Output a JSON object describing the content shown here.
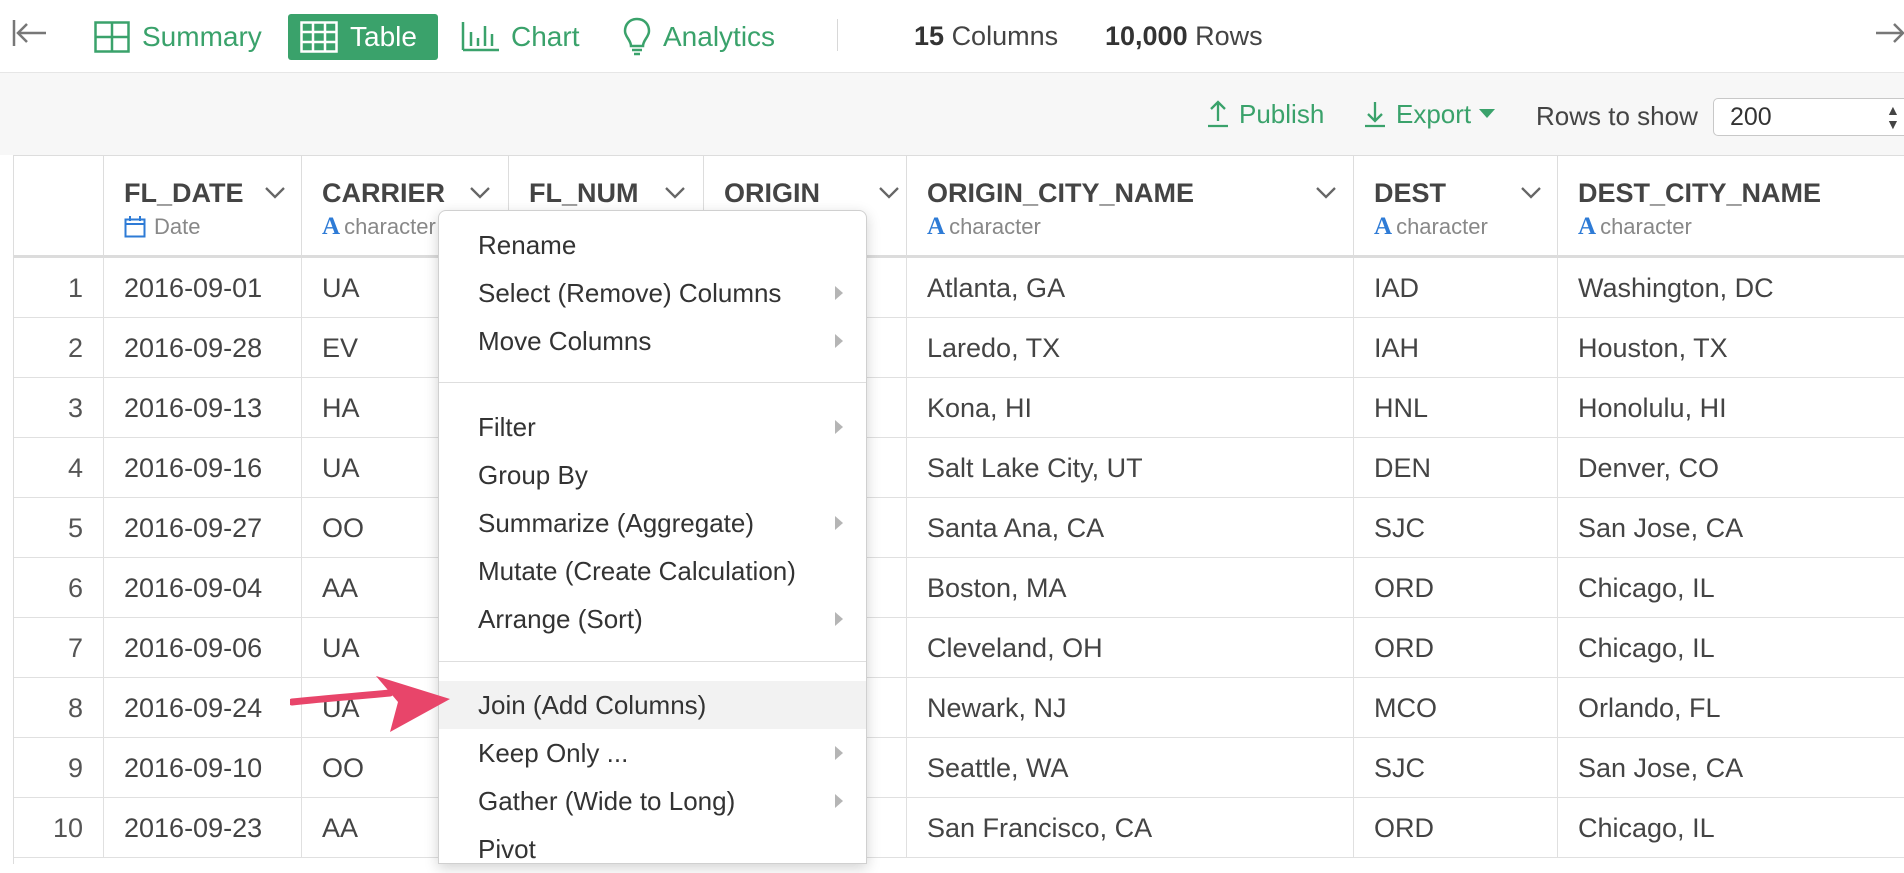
{
  "toolbar": {
    "tabs": [
      {
        "label": "Summary",
        "active": false
      },
      {
        "label": "Table",
        "active": true
      },
      {
        "label": "Chart",
        "active": false
      },
      {
        "label": "Analytics",
        "active": false
      }
    ],
    "columns_count": "15",
    "columns_word": "Columns",
    "rows_count": "10,000",
    "rows_word": "Rows"
  },
  "subbar": {
    "publish_label": "Publish",
    "export_label": "Export",
    "rows_to_show_label": "Rows to show",
    "rows_to_show_value": "200"
  },
  "table": {
    "columns": [
      {
        "name": "FL_DATE",
        "type": "Date"
      },
      {
        "name": "CARRIER",
        "type": "character"
      },
      {
        "name": "FL_NUM",
        "type": ""
      },
      {
        "name": "ORIGIN",
        "type": ""
      },
      {
        "name": "ORIGIN_CITY_NAME",
        "type": "character"
      },
      {
        "name": "DEST",
        "type": "character"
      },
      {
        "name": "DEST_CITY_NAME",
        "type": "character"
      }
    ],
    "rows": [
      {
        "n": "1",
        "fl_date": "2016-09-01",
        "carrier": "UA",
        "origin_city": "Atlanta, GA",
        "dest": "IAD",
        "dest_city": "Washington, DC"
      },
      {
        "n": "2",
        "fl_date": "2016-09-28",
        "carrier": "EV",
        "origin_city": "Laredo, TX",
        "dest": "IAH",
        "dest_city": "Houston, TX"
      },
      {
        "n": "3",
        "fl_date": "2016-09-13",
        "carrier": "HA",
        "origin_city": "Kona, HI",
        "dest": "HNL",
        "dest_city": "Honolulu, HI"
      },
      {
        "n": "4",
        "fl_date": "2016-09-16",
        "carrier": "UA",
        "origin_city": "Salt Lake City, UT",
        "dest": "DEN",
        "dest_city": "Denver, CO"
      },
      {
        "n": "5",
        "fl_date": "2016-09-27",
        "carrier": "OO",
        "origin_city": "Santa Ana, CA",
        "dest": "SJC",
        "dest_city": "San Jose, CA"
      },
      {
        "n": "6",
        "fl_date": "2016-09-04",
        "carrier": "AA",
        "origin_city": "Boston, MA",
        "dest": "ORD",
        "dest_city": "Chicago, IL"
      },
      {
        "n": "7",
        "fl_date": "2016-09-06",
        "carrier": "UA",
        "origin_city": "Cleveland, OH",
        "dest": "ORD",
        "dest_city": "Chicago, IL"
      },
      {
        "n": "8",
        "fl_date": "2016-09-24",
        "carrier": "UA",
        "origin_city": "Newark, NJ",
        "dest": "MCO",
        "dest_city": "Orlando, FL"
      },
      {
        "n": "9",
        "fl_date": "2016-09-10",
        "carrier": "OO",
        "origin_city": "Seattle, WA",
        "dest": "SJC",
        "dest_city": "San Jose, CA"
      },
      {
        "n": "10",
        "fl_date": "2016-09-23",
        "carrier": "AA",
        "origin_city": "San Francisco, CA",
        "dest": "ORD",
        "dest_city": "Chicago, IL"
      }
    ]
  },
  "context_menu": {
    "items": [
      {
        "label": "Rename",
        "submenu": false
      },
      {
        "label": "Select (Remove) Columns",
        "submenu": true
      },
      {
        "label": "Move Columns",
        "submenu": true
      },
      {
        "label": "Filter",
        "submenu": true
      },
      {
        "label": "Group By",
        "submenu": false
      },
      {
        "label": "Summarize (Aggregate)",
        "submenu": true
      },
      {
        "label": "Mutate (Create Calculation)",
        "submenu": false
      },
      {
        "label": "Arrange (Sort)",
        "submenu": true
      },
      {
        "label": "Join (Add Columns)",
        "submenu": false,
        "highlighted": true
      },
      {
        "label": "Keep Only ...",
        "submenu": true
      },
      {
        "label": "Gather (Wide to Long)",
        "submenu": true
      },
      {
        "label": "Pivot",
        "submenu": false
      }
    ]
  },
  "colors": {
    "accent": "#3aa26b",
    "type_icon": "#2e7bd6",
    "annotation_arrow": "#e8456a"
  }
}
